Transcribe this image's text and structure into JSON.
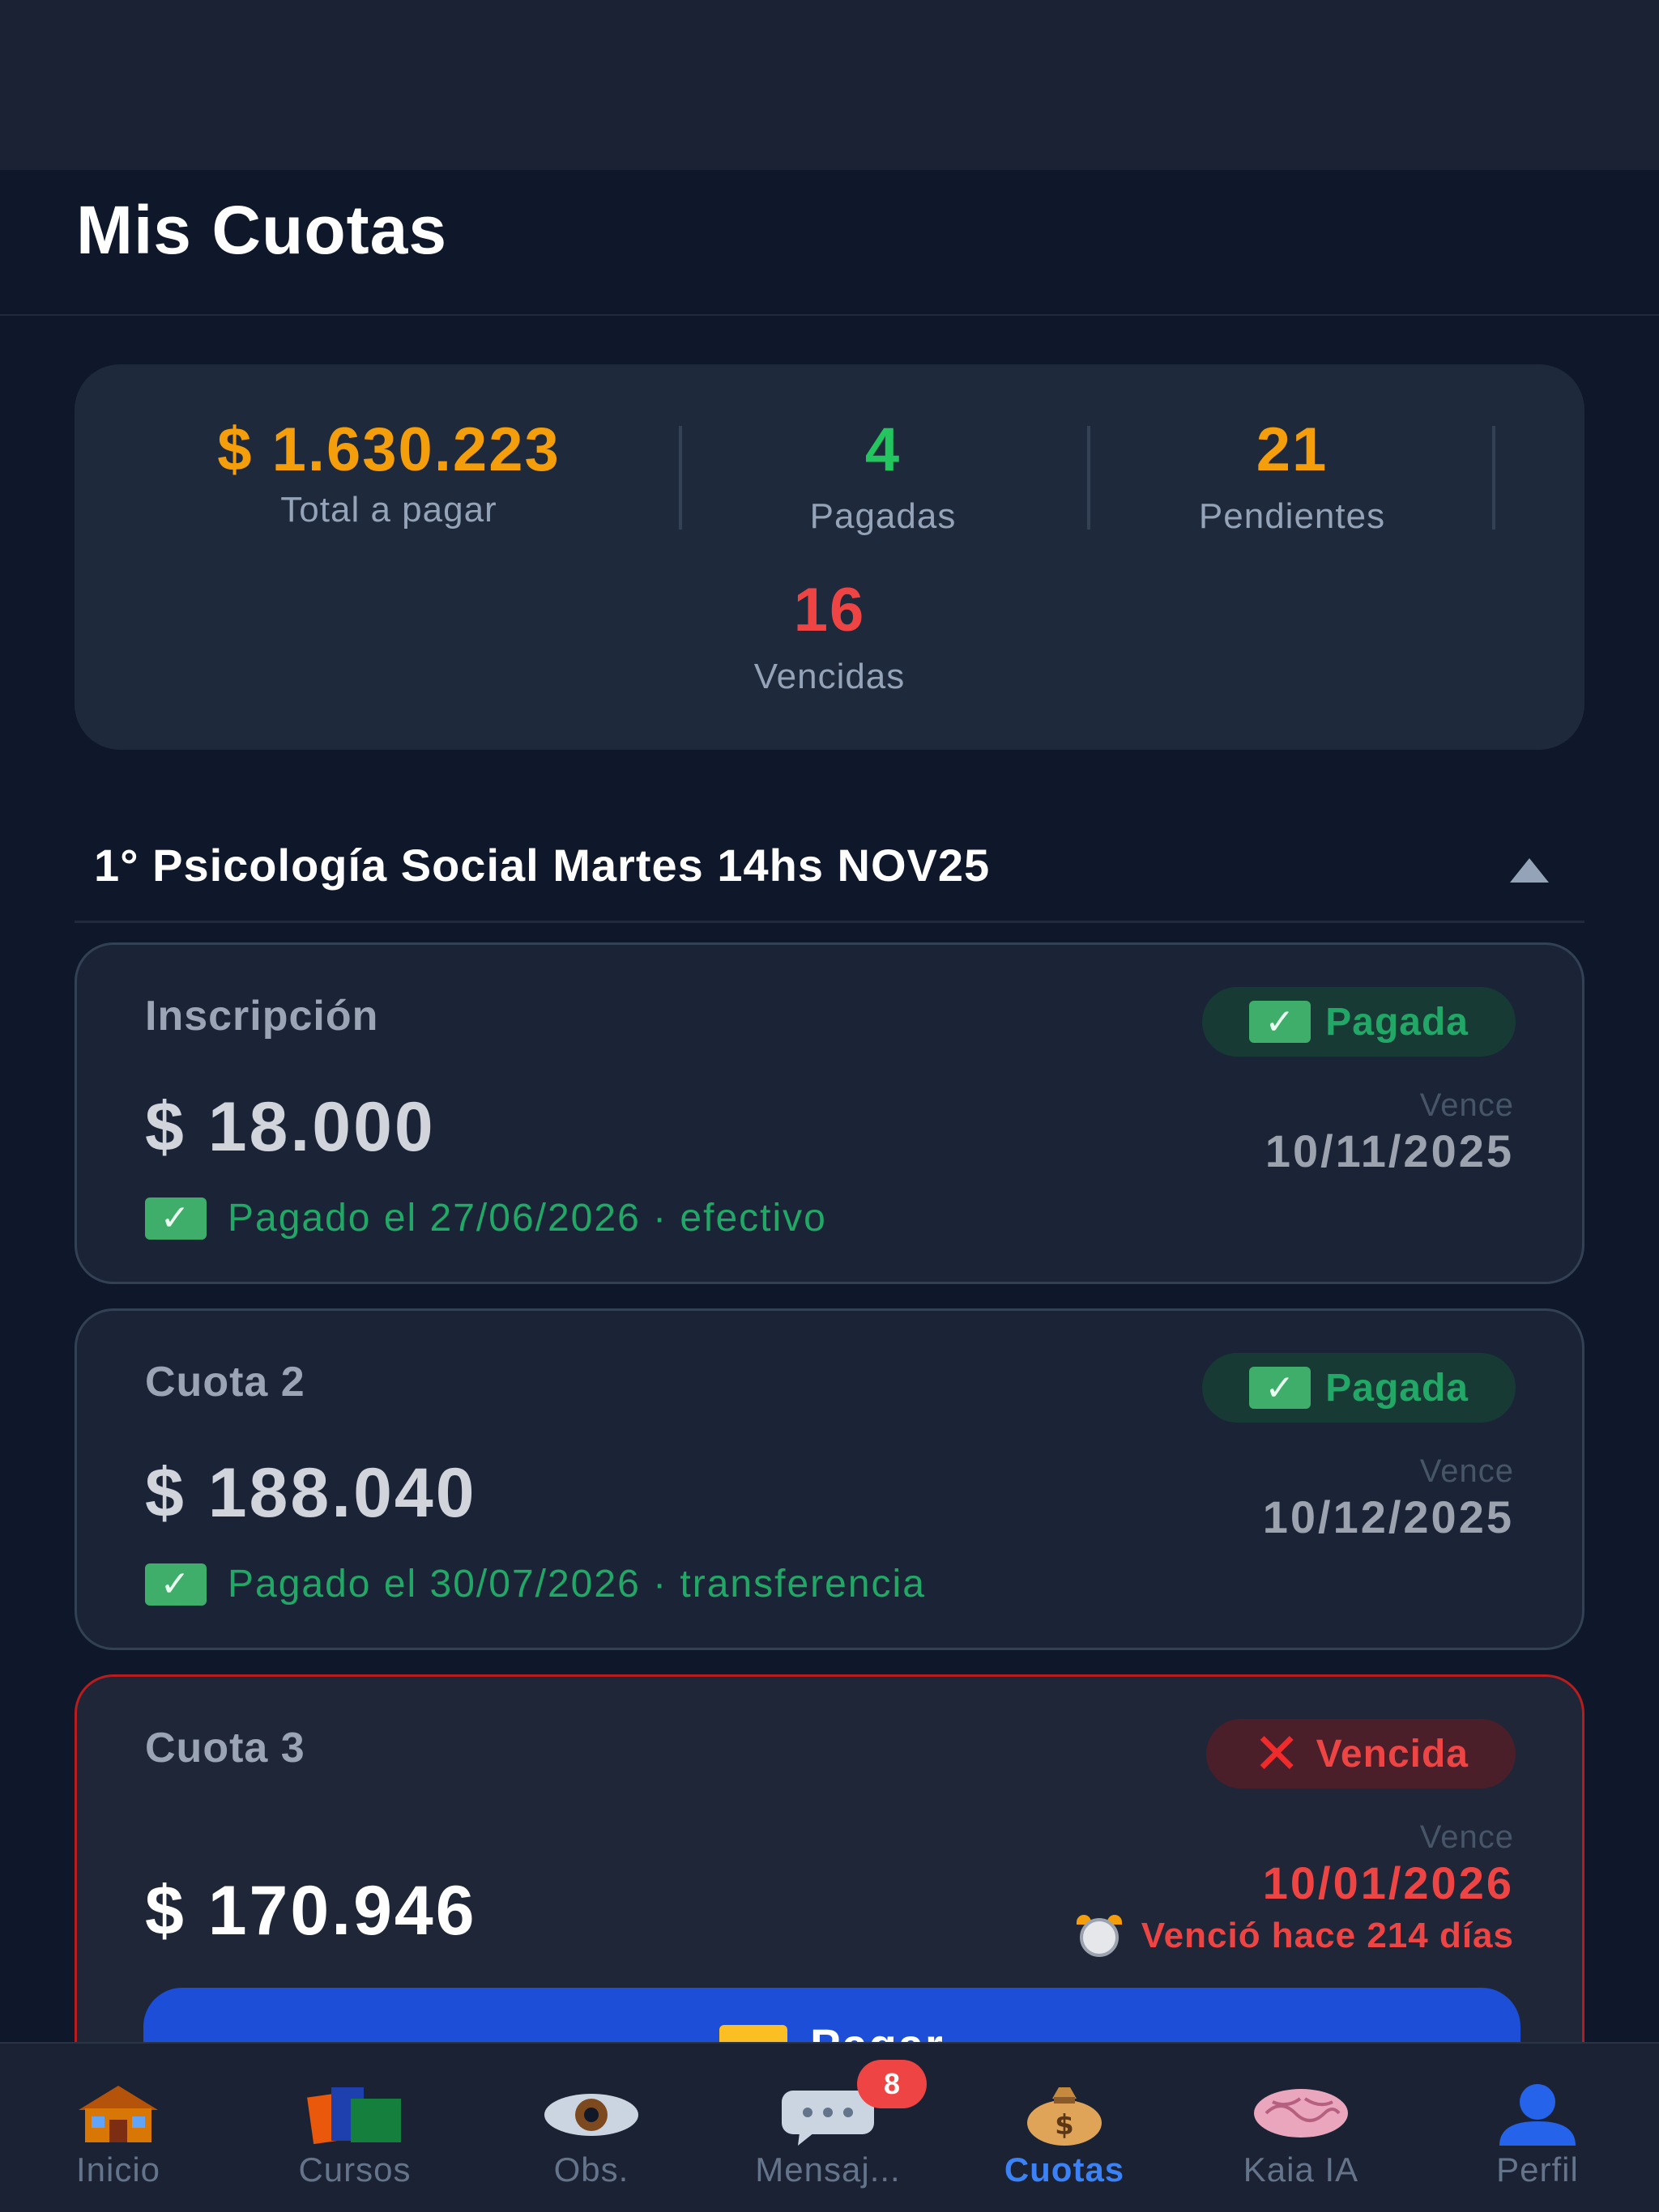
{
  "header": {
    "title": "Mis Cuotas"
  },
  "summary": {
    "total": {
      "value": "$ 1.630.223",
      "label": "Total a pagar",
      "color": "#f59e0b"
    },
    "paid": {
      "value": "4",
      "label": "Pagadas",
      "color": "#22c55e"
    },
    "pending": {
      "value": "21",
      "label": "Pendientes",
      "color": "#f59e0b"
    },
    "overdue": {
      "value": "16",
      "label": "Vencidas",
      "color": "#ef4444"
    }
  },
  "course": {
    "title": "1° Psicología Social Martes 14hs NOV25",
    "expanded": true
  },
  "fees": [
    {
      "name": "Inscripción",
      "status": "Pagada",
      "amount": "$ 18.000",
      "due_label": "Vence",
      "due_date": "10/11/2025",
      "note": "Pagado el 27/06/2026 · efectivo"
    },
    {
      "name": "Cuota 2",
      "status": "Pagada",
      "amount": "$ 188.040",
      "due_label": "Vence",
      "due_date": "10/12/2025",
      "note": "Pagado el 30/07/2026 · transferencia"
    },
    {
      "name": "Cuota 3",
      "status": "Vencida",
      "amount": "$ 170.946",
      "due_label": "Vence",
      "due_date": "10/01/2026",
      "note": "Venció hace 214 días",
      "button": "Pagar"
    }
  ],
  "tabbar": {
    "items": [
      {
        "label": "Inicio",
        "icon": "house-icon"
      },
      {
        "label": "Cursos",
        "icon": "books-icon"
      },
      {
        "label": "Obs.",
        "icon": "eye-icon"
      },
      {
        "label": "Mensaj...",
        "icon": "speech-bubble-icon",
        "badge": "8"
      },
      {
        "label": "Cuotas",
        "icon": "money-bag-icon",
        "active": true
      },
      {
        "label": "Kaia IA",
        "icon": "brain-icon"
      },
      {
        "label": "Perfil",
        "icon": "user-icon"
      }
    ]
  }
}
